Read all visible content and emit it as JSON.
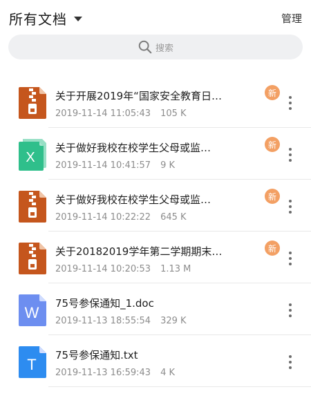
{
  "header": {
    "title": "所有文档",
    "manage_label": "管理"
  },
  "search": {
    "placeholder": "搜索"
  },
  "colors": {
    "zip": "#c5561d",
    "excel": "#2fbf8b",
    "word": "#6d8ef0",
    "text": "#2d8cf0",
    "badge": "#f3a064"
  },
  "files": [
    {
      "icon": "zip-file-icon",
      "name": "关于开展2019年“国家安全教育日…",
      "date": "2019-11-14 11:05:43",
      "size": "105 K",
      "badge": "新"
    },
    {
      "icon": "excel-file-icon",
      "icon_letter": "X",
      "name": "关于做好我校在校学生父母或监…",
      "date": "2019-11-14 10:41:57",
      "size": "9 K",
      "badge": "新"
    },
    {
      "icon": "zip-file-icon",
      "name": "关于做好我校在校学生父母或监…",
      "date": "2019-11-14 10:22:22",
      "size": "645 K",
      "badge": "新"
    },
    {
      "icon": "zip-file-icon",
      "name": "关于20182019学年第二学期期末…",
      "date": "2019-11-14 10:20:53",
      "size": "1.13 M",
      "badge": "新"
    },
    {
      "icon": "word-file-icon",
      "icon_letter": "W",
      "name": "75号参保通知_1.doc",
      "date": "2019-11-13 18:55:54",
      "size": "329 K",
      "badge": ""
    },
    {
      "icon": "text-file-icon",
      "icon_letter": "T",
      "name": "75号参保通知.txt",
      "date": "2019-11-13 16:59:43",
      "size": "4 K",
      "badge": ""
    }
  ]
}
